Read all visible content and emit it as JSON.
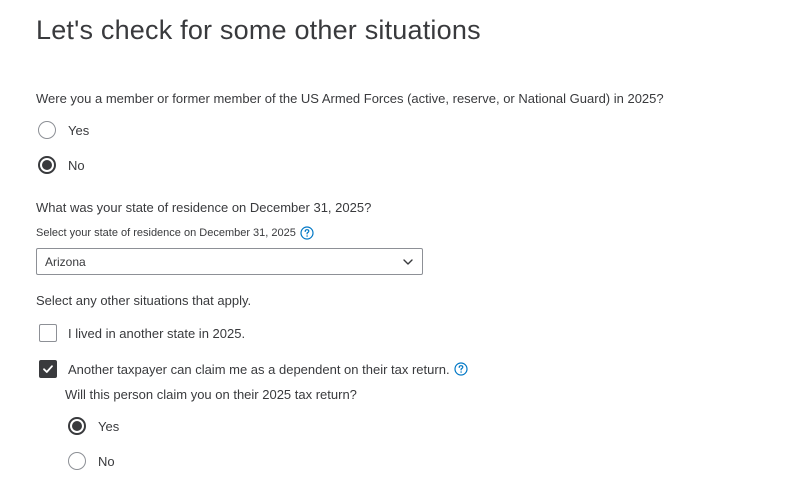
{
  "page": {
    "title": "Let's check for some other situations"
  },
  "military": {
    "question": "Were you a member or former member of the US Armed Forces (active, reserve, or National Guard) in 2025?",
    "options": [
      {
        "label": "Yes",
        "selected": false
      },
      {
        "label": "No",
        "selected": true
      }
    ]
  },
  "residence": {
    "question": "What was your state of residence on December 31, 2025?",
    "field_label": "Select your state of residence on December 31, 2025",
    "help_icon": "help-circle-icon",
    "selected_value": "Arizona",
    "dropdown_icon": "chevron-down-icon"
  },
  "situations": {
    "question": "Select any other situations that apply.",
    "items": [
      {
        "label": "I lived in another state in 2025.",
        "checked": false
      },
      {
        "label": "Another taxpayer can claim me as a dependent on their tax return.",
        "checked": true,
        "help_icon": "help-circle-icon"
      }
    ]
  },
  "dependent_claim": {
    "question": "Will this person claim you on their 2025 tax return?",
    "options": [
      {
        "label": "Yes",
        "selected": true
      },
      {
        "label": "No",
        "selected": false
      }
    ]
  },
  "colors": {
    "text": "#393a3d",
    "border": "#8d9096",
    "help_icon": "#0077c5"
  }
}
